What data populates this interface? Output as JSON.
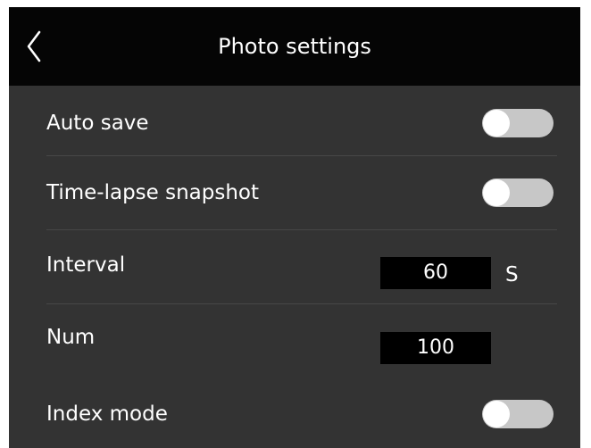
{
  "header": {
    "title": "Photo settings",
    "back_icon": "chevron-left-icon"
  },
  "settings": {
    "auto_save": {
      "label": "Auto save",
      "enabled": false
    },
    "time_lapse": {
      "label": "Time-lapse snapshot",
      "enabled": false
    },
    "interval": {
      "label": "Interval",
      "value": "60",
      "unit": "S"
    },
    "num": {
      "label": "Num",
      "value": "100"
    },
    "index_mode": {
      "label": "Index mode",
      "enabled": false
    }
  },
  "colors": {
    "header_bg": "#050505",
    "panel_bg": "#333333",
    "toggle_off": "#c7c7c7",
    "input_bg": "#000000"
  }
}
